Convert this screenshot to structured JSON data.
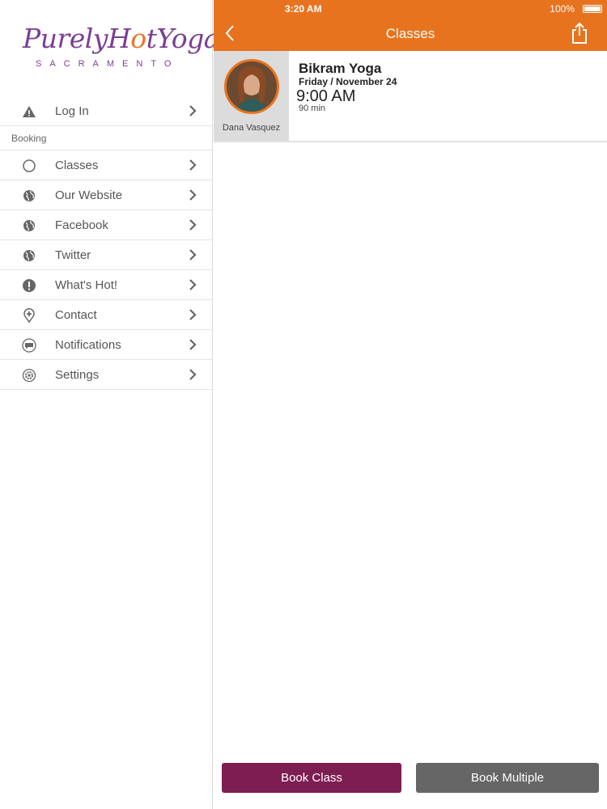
{
  "logo": {
    "text_a": "PurelyH",
    "text_hot": "o",
    "text_b": "tYoga",
    "sub": "SACRAMENTO"
  },
  "status_bar": {
    "time": "3:20 AM",
    "battery": "100%"
  },
  "sidebar": {
    "login": {
      "label": "Log In",
      "icon": "warning-icon"
    },
    "section": "Booking",
    "items": [
      {
        "label": "Classes",
        "icon": "circle-icon"
      },
      {
        "label": "Our Website",
        "icon": "globe-icon"
      },
      {
        "label": "Facebook",
        "icon": "globe-icon"
      },
      {
        "label": "Twitter",
        "icon": "globe-icon"
      },
      {
        "label": "What's Hot!",
        "icon": "exclamation-icon"
      },
      {
        "label": "Contact",
        "icon": "map-pin-icon"
      },
      {
        "label": "Notifications",
        "icon": "chat-bubble-icon"
      },
      {
        "label": "Settings",
        "icon": "gear-icon"
      }
    ]
  },
  "navbar": {
    "title": "Classes",
    "color": "#e8731f"
  },
  "class": {
    "name": "Bikram Yoga",
    "date": "Friday / November 24",
    "time": "9:00 AM",
    "duration": "90 min",
    "teacher": "Dana Vasquez"
  },
  "buttons": {
    "book": "Book Class",
    "book_multiple": "Book Multiple"
  },
  "colors": {
    "accent": "#e8731f",
    "book": "#7d1d52",
    "multi": "#666666",
    "brand_purple": "#7b3e93"
  }
}
